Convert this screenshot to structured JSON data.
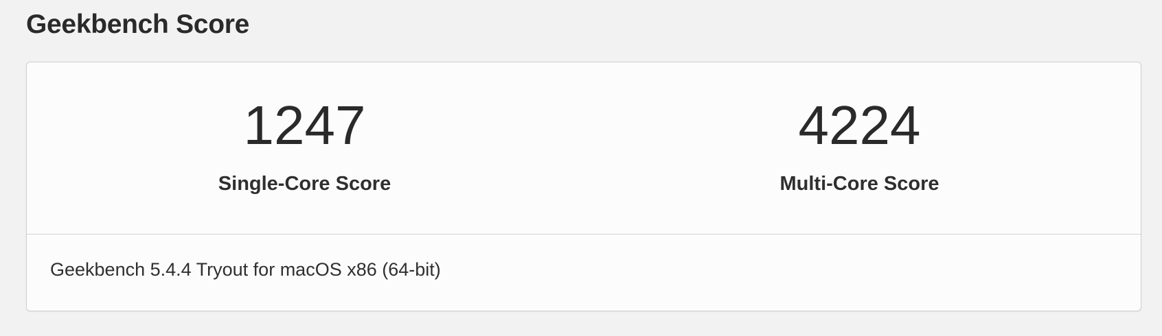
{
  "page": {
    "title": "Geekbench Score"
  },
  "scores": {
    "single_core": {
      "value": "1247",
      "label": "Single-Core Score"
    },
    "multi_core": {
      "value": "4224",
      "label": "Multi-Core Score"
    }
  },
  "footer": {
    "version_text": "Geekbench 5.4.4 Tryout for macOS x86 (64-bit)"
  },
  "colors": {
    "background": "#f2f2f2",
    "card_background": "#fcfcfc",
    "border": "#cfcfcf",
    "text": "#2b2b2b"
  }
}
